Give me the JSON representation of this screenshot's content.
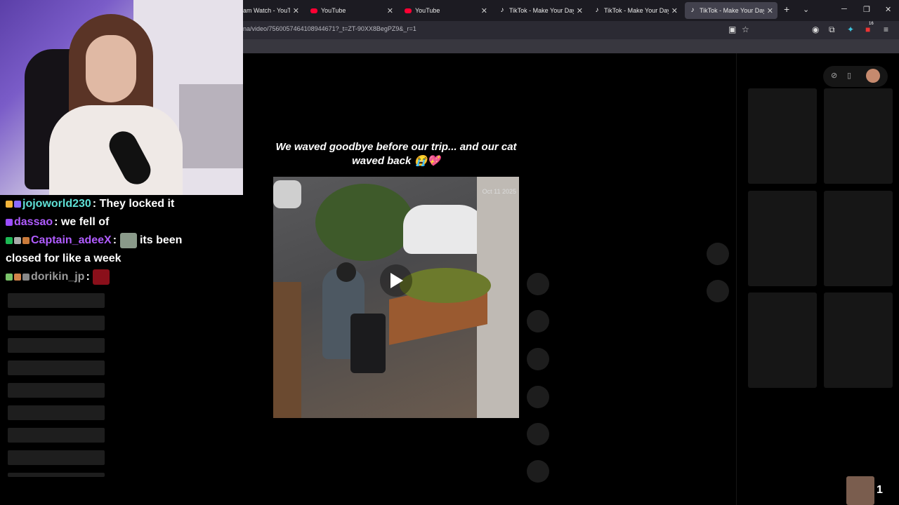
{
  "browser": {
    "tabs": [
      {
        "label": "am Watch - YouTube",
        "icon": "youtube-icon",
        "active": false
      },
      {
        "label": "YouTube",
        "icon": "youtube-icon",
        "active": false
      },
      {
        "label": "YouTube",
        "icon": "youtube-icon",
        "active": false
      },
      {
        "label": "TikTok - Make Your Day",
        "icon": "tiktok-icon",
        "active": false
      },
      {
        "label": "TikTok - Make Your Day",
        "icon": "tiktok-icon",
        "active": false
      },
      {
        "label": "TikTok - Make Your Day",
        "icon": "tiktok-icon",
        "active": true
      }
    ],
    "url": "na/video/7560057464108944671?_t=ZT-90XX8BegPZ9&_r=1",
    "extension_badge": "16",
    "close_glyph": "✕",
    "new_tab_glyph": "+",
    "list_tabs_glyph": "⌄",
    "minimize_glyph": "─",
    "restore_glyph": "❐",
    "window_close_glyph": "✕",
    "menu_glyph": "≡"
  },
  "tiktok": {
    "caption": "We waved goodbye before our trip... and our cat waved back 😭💖",
    "video_timestamp": "Oct 11 2025",
    "top_controls": {
      "compass_glyph": "⊘",
      "device_glyph": "▯"
    },
    "viewer_count": "1"
  },
  "chat": {
    "messages": [
      {
        "user": "jojoworld230",
        "separator": ":",
        "text": "They locked it",
        "name_color": "#5fe0d6"
      },
      {
        "user": "dassao",
        "separator": ":",
        "text": "we fell of",
        "name_color": "#b05cff"
      },
      {
        "user": "Captain_adeeX",
        "separator": ":",
        "text": "its been closed for like a week",
        "name_color": "#b05cff"
      },
      {
        "user": "dorikin_jp",
        "separator": ":",
        "text": "",
        "name_color": "#9a9a9a"
      }
    ]
  },
  "colors": {
    "tab_bar": "#1c1b22",
    "nav_bar": "#2b2a33",
    "page_bg": "#000000",
    "card": "#161616"
  }
}
